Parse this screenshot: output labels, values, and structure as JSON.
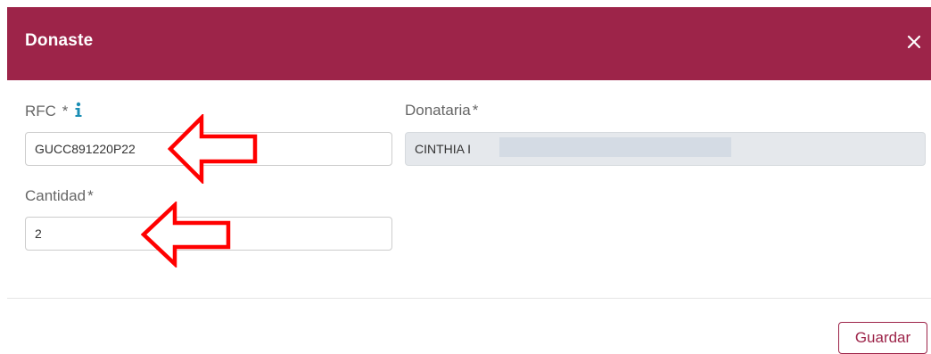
{
  "dialog": {
    "title": "Donaste",
    "close_label": "×"
  },
  "form": {
    "rfc": {
      "label": "RFC",
      "required_mark": "*",
      "value": "GUCC891220P22"
    },
    "donataria": {
      "label": "Donataria",
      "required_mark": "*",
      "value": "CINTHIA I"
    },
    "cantidad": {
      "label": "Cantidad",
      "required_mark": "*",
      "value": "2"
    }
  },
  "footer": {
    "save_label": "Guardar"
  },
  "colors": {
    "header_bg": "#9d2449",
    "accent": "#9d2449",
    "info_icon": "#1b8eb4",
    "annotation_arrow": "#ff0000"
  },
  "icons": {
    "close": "close-icon",
    "info": "info-icon",
    "annotation": "arrow-left-icon"
  }
}
